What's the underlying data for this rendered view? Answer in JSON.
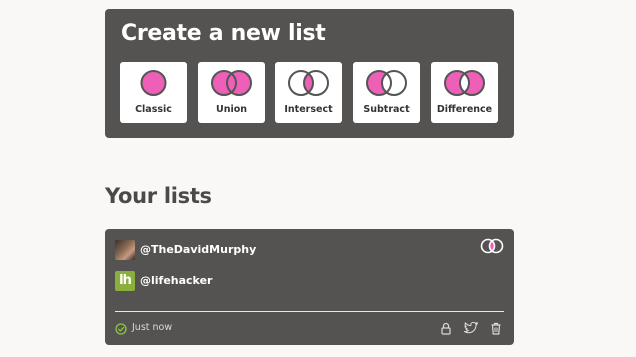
{
  "create": {
    "title": "Create a new list",
    "types": [
      {
        "label": "Classic",
        "icon": "classic-icon"
      },
      {
        "label": "Union",
        "icon": "union-icon"
      },
      {
        "label": "Intersect",
        "icon": "intersect-icon"
      },
      {
        "label": "Subtract",
        "icon": "subtract-icon"
      },
      {
        "label": "Difference",
        "icon": "difference-icon"
      }
    ]
  },
  "lists": {
    "title": "Your lists",
    "items": [
      {
        "members": [
          {
            "handle": "@TheDavidMurphy",
            "avatar": "photo-avatar"
          },
          {
            "handle": "@lifehacker",
            "avatar": "lifehacker-logo",
            "avatar_text": "lh"
          }
        ],
        "type_icon": "intersect-icon",
        "status": "Just now",
        "status_icon": "check-circle-icon",
        "actions": [
          "lock-icon",
          "twitter-icon",
          "trash-icon"
        ]
      }
    ]
  },
  "colors": {
    "background": "#faf8f6",
    "panel": "#545351",
    "accent": "#ee5fb8",
    "outline": "#555555",
    "success": "#8cc63f",
    "lifehacker": "#8cae3c"
  }
}
